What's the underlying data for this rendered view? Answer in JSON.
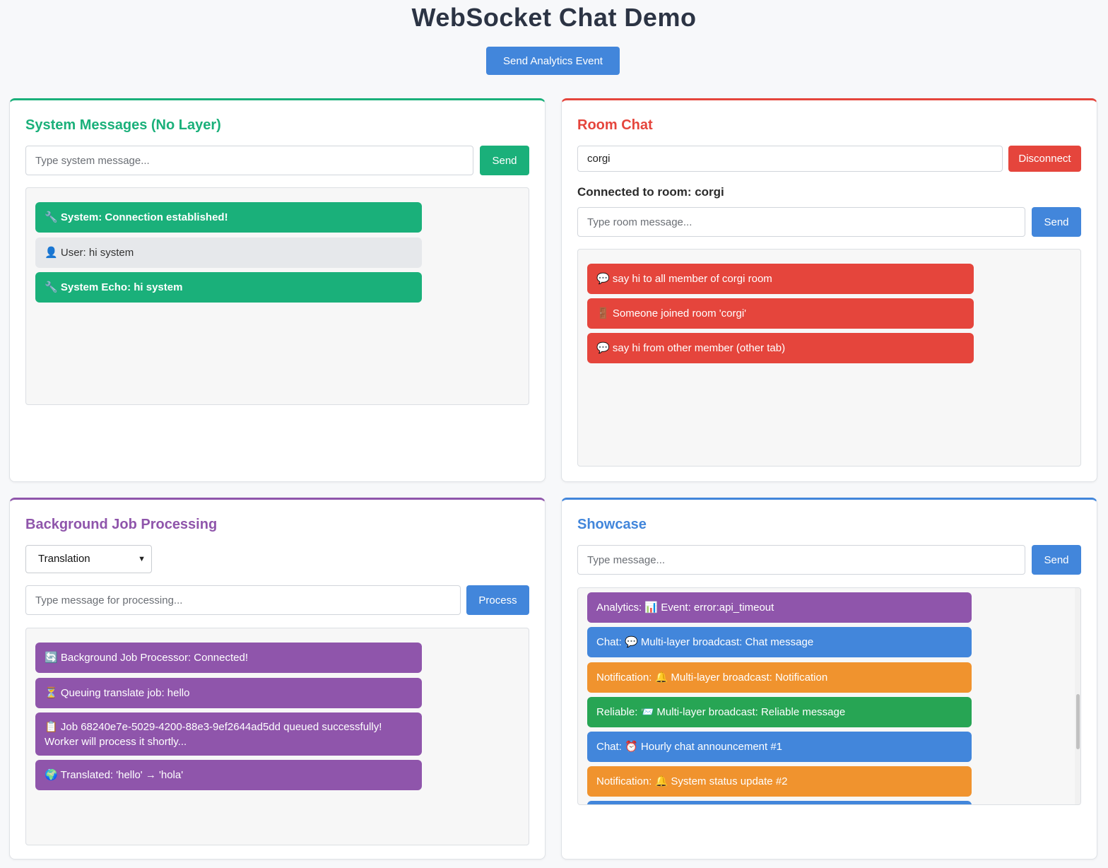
{
  "page": {
    "title": "WebSocket Chat Demo",
    "analytics_button": "Send Analytics Event"
  },
  "system": {
    "heading": "System Messages (No Layer)",
    "input_placeholder": "Type system message...",
    "send_label": "Send",
    "messages": [
      {
        "icon": "🔧",
        "text": "System: Connection established!"
      },
      {
        "icon": "👤",
        "text": "User: hi system"
      },
      {
        "icon": "🔧",
        "text": "System Echo: hi system"
      }
    ]
  },
  "room": {
    "heading": "Room Chat",
    "room_value": "corgi",
    "disconnect_label": "Disconnect",
    "status": "Connected to room: corgi",
    "input_placeholder": "Type room message...",
    "send_label": "Send",
    "messages": [
      {
        "icon": "💬",
        "text": "say hi to all member of corgi room"
      },
      {
        "icon": "🚪",
        "text": "Someone joined room 'corgi'"
      },
      {
        "icon": "💬",
        "text": "say hi from other member (other tab)"
      }
    ]
  },
  "job": {
    "heading": "Background Job Processing",
    "selected_option": "Translation",
    "input_placeholder": "Type message for processing...",
    "process_label": "Process",
    "messages": [
      {
        "icon": "🔄",
        "text": "Background Job Processor: Connected!"
      },
      {
        "icon": "⏳",
        "text": "Queuing translate job: hello"
      },
      {
        "icon": "📋",
        "text": "Job 68240e7e-5029-4200-88e3-9ef2644ad5dd queued successfully! Worker will process it shortly..."
      },
      {
        "icon": "🌍",
        "text": "Translated: 'hello' → 'hola'"
      }
    ]
  },
  "showcase": {
    "heading": "Showcase",
    "input_placeholder": "Type message...",
    "send_label": "Send",
    "messages": [
      {
        "prefix": "Analytics:",
        "icon": "📊",
        "text": "Event: error:api_timeout",
        "color": "#8f55ab"
      },
      {
        "prefix": "Chat:",
        "icon": "💬",
        "text": "Multi-layer broadcast: Chat message",
        "color": "#4286db"
      },
      {
        "prefix": "Notification:",
        "icon": "🔔",
        "text": "Multi-layer broadcast: Notification",
        "color": "#f0932e"
      },
      {
        "prefix": "Reliable:",
        "icon": "📨",
        "text": "Multi-layer broadcast: Reliable message",
        "color": "#27a554"
      },
      {
        "prefix": "Chat:",
        "icon": "⏰",
        "text": "Hourly chat announcement #1",
        "color": "#4286db"
      },
      {
        "prefix": "Notification:",
        "icon": "🔔",
        "text": "System status update #2",
        "color": "#f0932e"
      }
    ]
  }
}
